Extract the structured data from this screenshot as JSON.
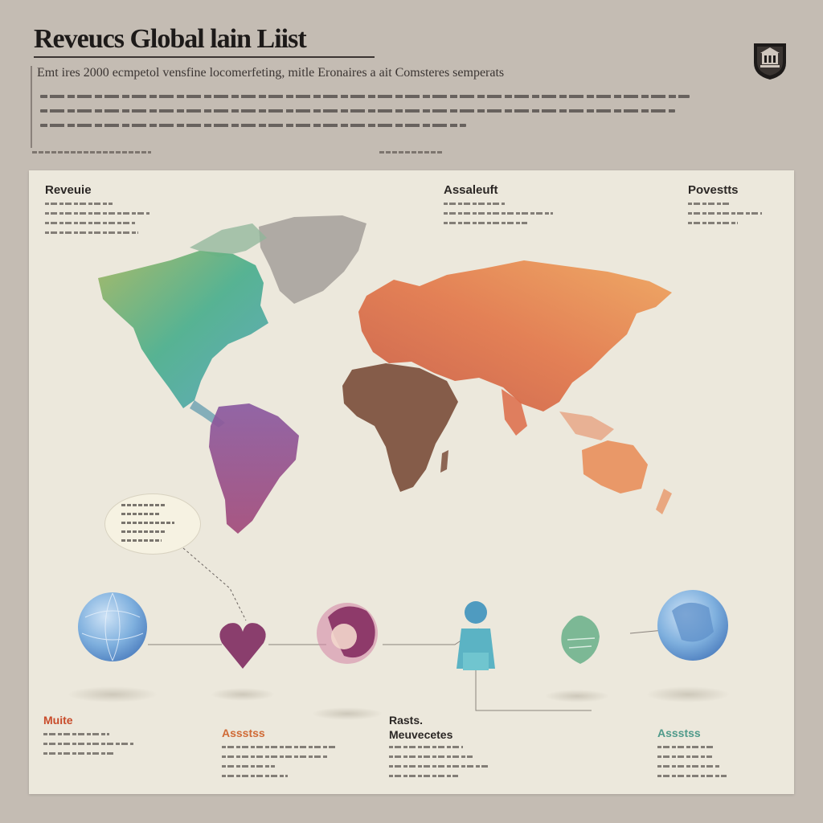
{
  "header": {
    "title": "Reveucs Global lain Liist",
    "subtitle": "Emt  ires 2000  ecmpetol vensfine locomerfeting, mitle Eronaires a ait Comsteres semperats"
  },
  "colors": {
    "background": "#c4bcb3",
    "panel": "#ece8dc",
    "north_america": "#4fb08f",
    "greenland": "#a9a39d",
    "south_america": "#9e4d87",
    "europe_asia": "#e2774a",
    "africa": "#7c4f3c",
    "australia": "#e88c58",
    "accent_red": "#c84b2a",
    "accent_orange": "#d06a36",
    "accent_teal": "#4f9a8a"
  },
  "columns": [
    {
      "title": "Reveuie"
    },
    {
      "title": "Assaleuft"
    },
    {
      "title": "Povestts"
    }
  ],
  "icons": [
    {
      "name": "globe-blue-left-icon"
    },
    {
      "name": "heart-map-pin-icon"
    },
    {
      "name": "world-map-orb-icon"
    },
    {
      "name": "person-figure-icon"
    },
    {
      "name": "leaf-map-pin-icon"
    },
    {
      "name": "globe-blue-right-icon"
    }
  ],
  "bottom_items": [
    {
      "label": "Muite",
      "color": "#c84b2a"
    },
    {
      "label": "Assstss",
      "color": "#d06a36"
    },
    {
      "label": "Rasts.",
      "color": "#2b2725"
    },
    {
      "label": "Meuvecetes",
      "color": "#2b2725"
    },
    {
      "label": "Assstss",
      "color": "#4f9a8a"
    }
  ]
}
